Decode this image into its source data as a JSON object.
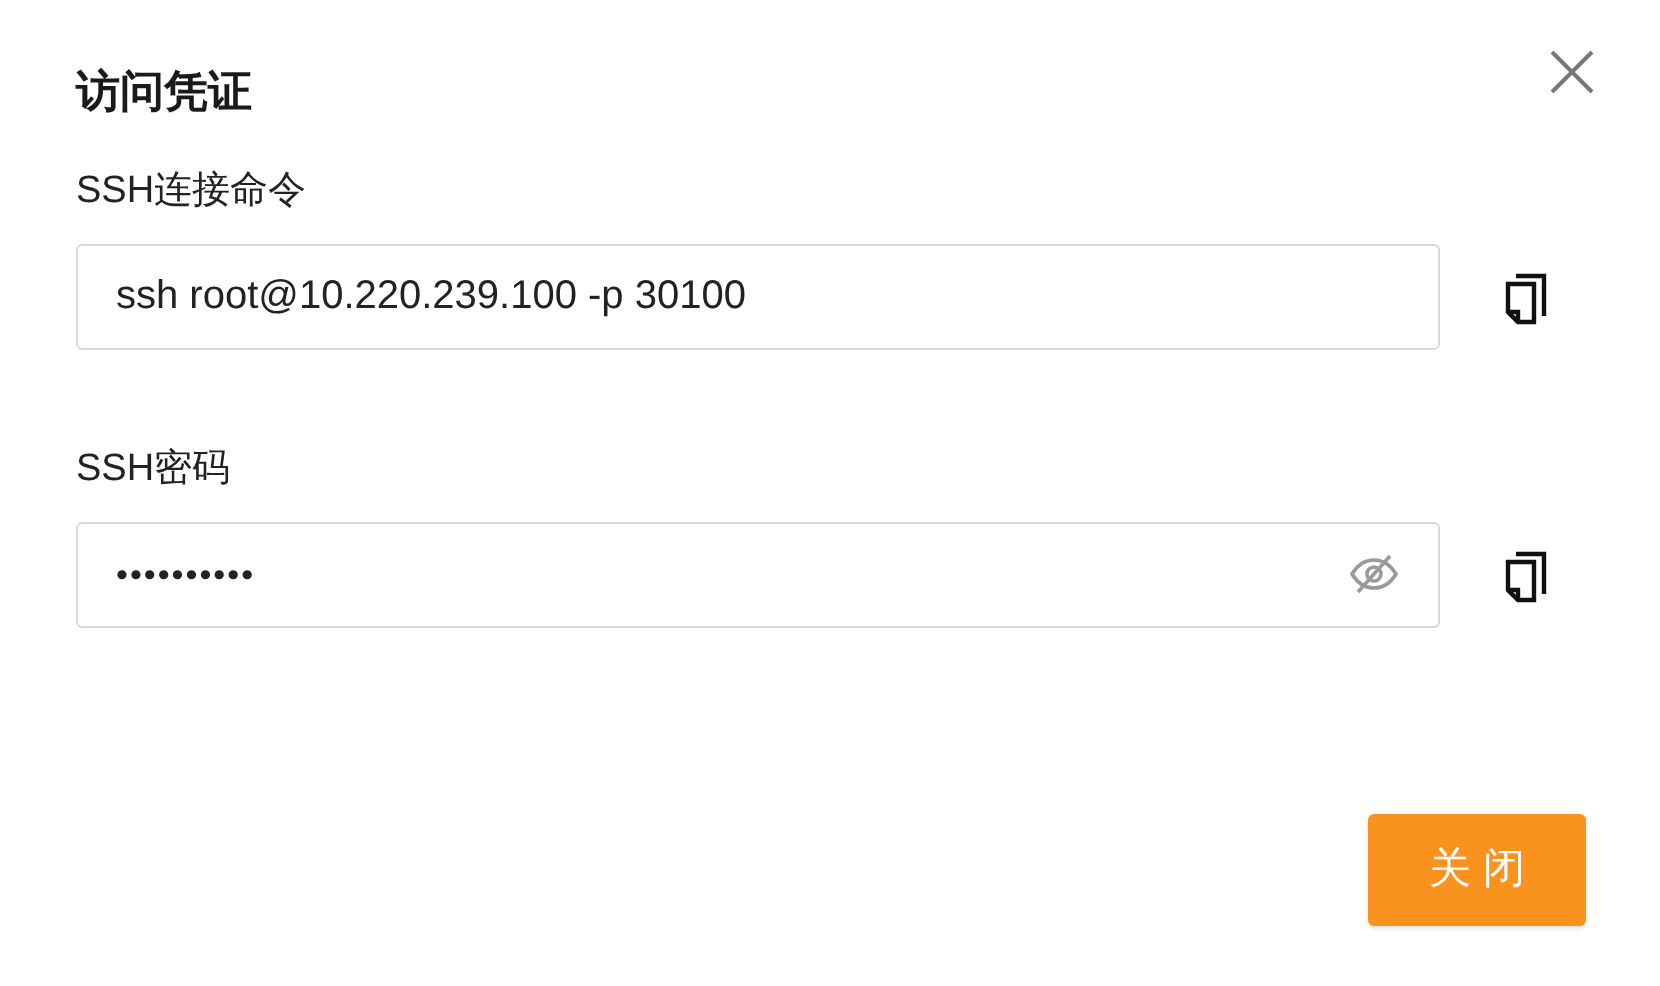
{
  "dialog": {
    "title": "访问凭证"
  },
  "fields": [
    {
      "label": "SSH连接命令",
      "value": "ssh root@10.220.239.100 -p 30100",
      "kind": "text"
    },
    {
      "label": "SSH密码",
      "value": "••••••••••",
      "kind": "password",
      "masked": true
    }
  ],
  "buttons": [
    {
      "label": "关 闭"
    }
  ]
}
